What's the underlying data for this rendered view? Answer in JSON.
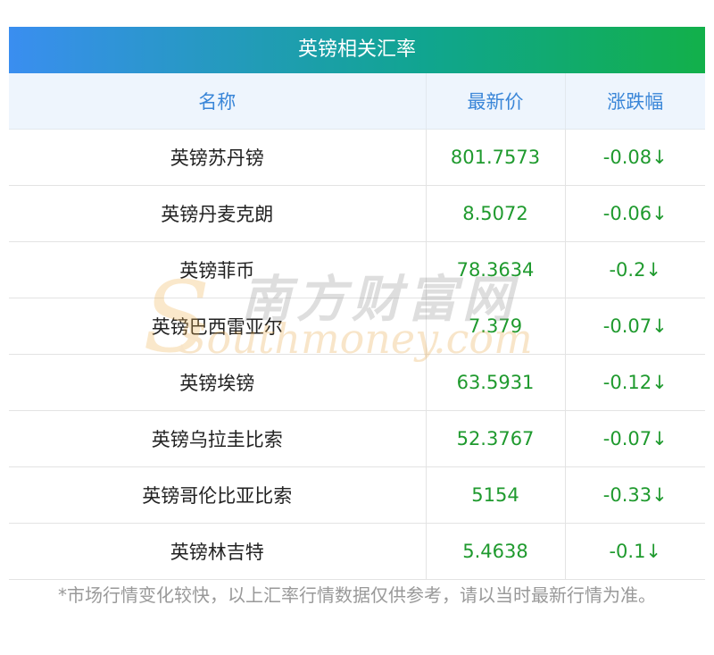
{
  "table_title": "英镑相关汇率",
  "columns": [
    "名称",
    "最新价",
    "涨跌幅"
  ],
  "rows": [
    {
      "name": "英镑苏丹镑",
      "price": "801.7573",
      "change": "-0.08↓"
    },
    {
      "name": "英镑丹麦克朗",
      "price": "8.5072",
      "change": "-0.06↓"
    },
    {
      "name": "英镑菲币",
      "price": "78.3634",
      "change": "-0.2↓"
    },
    {
      "name": "英镑巴西雷亚尔",
      "price": "7.379",
      "change": "-0.07↓"
    },
    {
      "name": "英镑埃镑",
      "price": "63.5931",
      "change": "-0.12↓"
    },
    {
      "name": "英镑乌拉圭比索",
      "price": "52.3767",
      "change": "-0.07↓"
    },
    {
      "name": "英镑哥伦比亚比索",
      "price": "5154",
      "change": "-0.33↓"
    },
    {
      "name": "英镑林吉特",
      "price": "5.4638",
      "change": "-0.1↓"
    }
  ],
  "watermark": {
    "chinese": "南方财富网",
    "english": "Southmoney.com"
  },
  "footnote": "*市场行情变化较快，以上汇率行情数据仅供参考，请以当时最新行情为准。",
  "colors": {
    "header_gradient_start": "#3a8ef0",
    "header_gradient_end": "#12b04a",
    "value_green": "#1f9a2e",
    "column_header_blue": "#3a86d8"
  }
}
